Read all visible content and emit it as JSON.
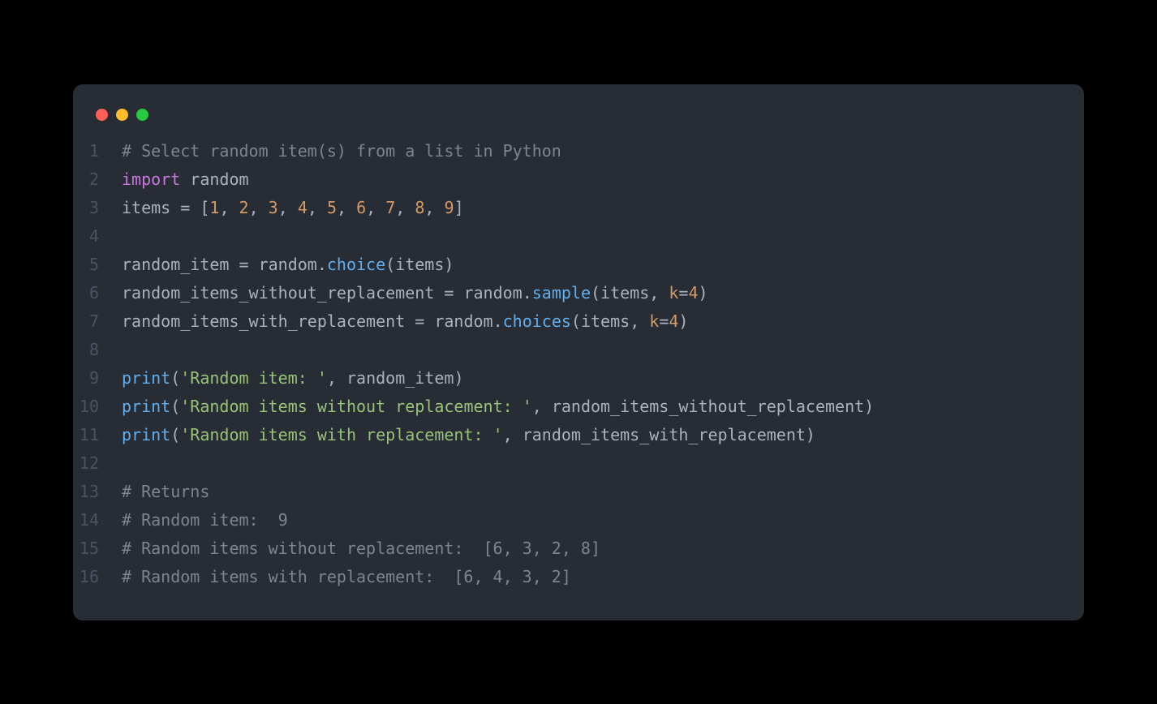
{
  "window": {
    "buttons": [
      "close",
      "minimize",
      "zoom"
    ]
  },
  "code": {
    "lines": [
      {
        "n": "1",
        "tokens": [
          {
            "c": "cm",
            "t": "# Select random item(s) from a list in Python"
          }
        ]
      },
      {
        "n": "2",
        "tokens": [
          {
            "c": "kw",
            "t": "import"
          },
          {
            "c": "var",
            "t": " random"
          }
        ]
      },
      {
        "n": "3",
        "tokens": [
          {
            "c": "var",
            "t": "items "
          },
          {
            "c": "op",
            "t": "="
          },
          {
            "c": "var",
            "t": " "
          },
          {
            "c": "pn",
            "t": "["
          },
          {
            "c": "num",
            "t": "1"
          },
          {
            "c": "pn",
            "t": ", "
          },
          {
            "c": "num",
            "t": "2"
          },
          {
            "c": "pn",
            "t": ", "
          },
          {
            "c": "num",
            "t": "3"
          },
          {
            "c": "pn",
            "t": ", "
          },
          {
            "c": "num",
            "t": "4"
          },
          {
            "c": "pn",
            "t": ", "
          },
          {
            "c": "num",
            "t": "5"
          },
          {
            "c": "pn",
            "t": ", "
          },
          {
            "c": "num",
            "t": "6"
          },
          {
            "c": "pn",
            "t": ", "
          },
          {
            "c": "num",
            "t": "7"
          },
          {
            "c": "pn",
            "t": ", "
          },
          {
            "c": "num",
            "t": "8"
          },
          {
            "c": "pn",
            "t": ", "
          },
          {
            "c": "num",
            "t": "9"
          },
          {
            "c": "pn",
            "t": "]"
          }
        ]
      },
      {
        "n": "4",
        "tokens": []
      },
      {
        "n": "5",
        "tokens": [
          {
            "c": "var",
            "t": "random_item "
          },
          {
            "c": "op",
            "t": "="
          },
          {
            "c": "var",
            "t": " random"
          },
          {
            "c": "pn",
            "t": "."
          },
          {
            "c": "fn",
            "t": "choice"
          },
          {
            "c": "pn",
            "t": "("
          },
          {
            "c": "var",
            "t": "items"
          },
          {
            "c": "pn",
            "t": ")"
          }
        ]
      },
      {
        "n": "6",
        "tokens": [
          {
            "c": "var",
            "t": "random_items_without_replacement "
          },
          {
            "c": "op",
            "t": "="
          },
          {
            "c": "var",
            "t": " random"
          },
          {
            "c": "pn",
            "t": "."
          },
          {
            "c": "fn",
            "t": "sample"
          },
          {
            "c": "pn",
            "t": "("
          },
          {
            "c": "var",
            "t": "items"
          },
          {
            "c": "pn",
            "t": ", "
          },
          {
            "c": "arg",
            "t": "k"
          },
          {
            "c": "op",
            "t": "="
          },
          {
            "c": "num",
            "t": "4"
          },
          {
            "c": "pn",
            "t": ")"
          }
        ]
      },
      {
        "n": "7",
        "tokens": [
          {
            "c": "var",
            "t": "random_items_with_replacement "
          },
          {
            "c": "op",
            "t": "="
          },
          {
            "c": "var",
            "t": " random"
          },
          {
            "c": "pn",
            "t": "."
          },
          {
            "c": "fn",
            "t": "choices"
          },
          {
            "c": "pn",
            "t": "("
          },
          {
            "c": "var",
            "t": "items"
          },
          {
            "c": "pn",
            "t": ", "
          },
          {
            "c": "arg",
            "t": "k"
          },
          {
            "c": "op",
            "t": "="
          },
          {
            "c": "num",
            "t": "4"
          },
          {
            "c": "pn",
            "t": ")"
          }
        ]
      },
      {
        "n": "8",
        "tokens": []
      },
      {
        "n": "9",
        "tokens": [
          {
            "c": "fn",
            "t": "print"
          },
          {
            "c": "pn",
            "t": "("
          },
          {
            "c": "str",
            "t": "'Random item: '"
          },
          {
            "c": "pn",
            "t": ", "
          },
          {
            "c": "var",
            "t": "random_item"
          },
          {
            "c": "pn",
            "t": ")"
          }
        ]
      },
      {
        "n": "10",
        "tokens": [
          {
            "c": "fn",
            "t": "print"
          },
          {
            "c": "pn",
            "t": "("
          },
          {
            "c": "str",
            "t": "'Random items without replacement: '"
          },
          {
            "c": "pn",
            "t": ", "
          },
          {
            "c": "var",
            "t": "random_items_without_replacement"
          },
          {
            "c": "pn",
            "t": ")"
          }
        ]
      },
      {
        "n": "11",
        "tokens": [
          {
            "c": "fn",
            "t": "print"
          },
          {
            "c": "pn",
            "t": "("
          },
          {
            "c": "str",
            "t": "'Random items with replacement: '"
          },
          {
            "c": "pn",
            "t": ", "
          },
          {
            "c": "var",
            "t": "random_items_with_replacement"
          },
          {
            "c": "pn",
            "t": ")"
          }
        ]
      },
      {
        "n": "12",
        "tokens": []
      },
      {
        "n": "13",
        "tokens": [
          {
            "c": "cm",
            "t": "# Returns"
          }
        ]
      },
      {
        "n": "14",
        "tokens": [
          {
            "c": "cm",
            "t": "# Random item:  9"
          }
        ]
      },
      {
        "n": "15",
        "tokens": [
          {
            "c": "cm",
            "t": "# Random items without replacement:  [6, 3, 2, 8]"
          }
        ]
      },
      {
        "n": "16",
        "tokens": [
          {
            "c": "cm",
            "t": "# Random items with replacement:  [6, 4, 3, 2]"
          }
        ]
      }
    ]
  }
}
